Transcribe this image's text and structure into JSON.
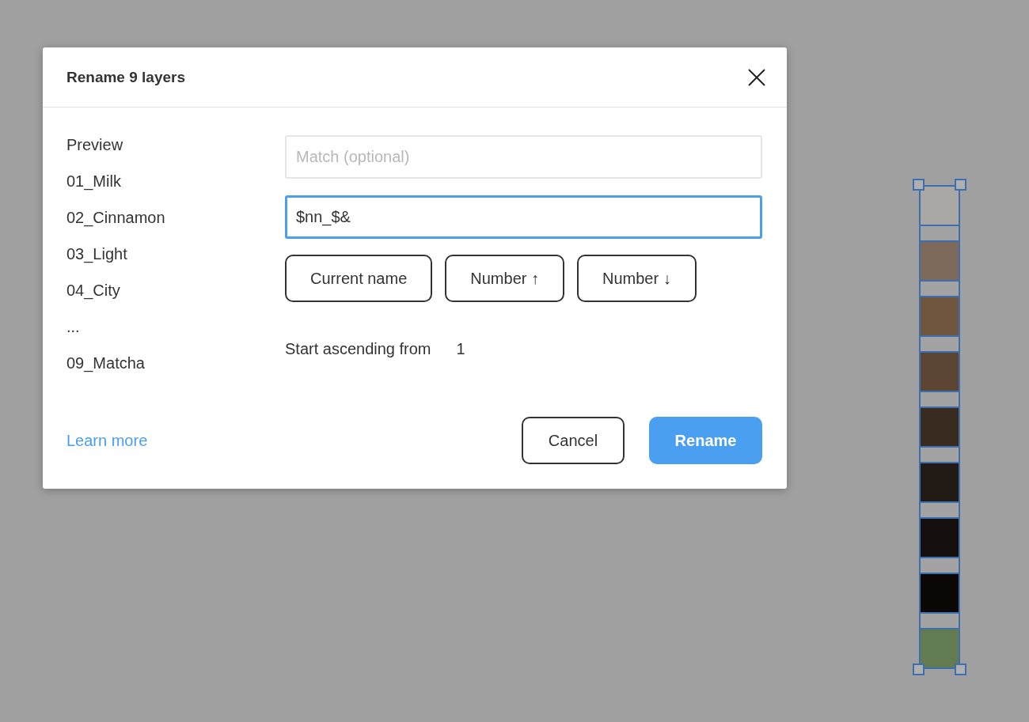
{
  "dialog": {
    "title": "Rename 9 layers",
    "preview": {
      "heading": "Preview",
      "items": [
        "01_Milk",
        "02_Cinnamon",
        "03_Light",
        "04_City",
        "...",
        "09_Matcha"
      ]
    },
    "match_field": {
      "placeholder": "Match (optional)",
      "focused": false
    },
    "rename_field": {
      "value": "$nn_$&",
      "focused": true
    },
    "token_buttons": [
      "Current name",
      "Number ↑",
      "Number ↓"
    ],
    "start": {
      "label": "Start ascending from",
      "value": "1"
    },
    "learn_more": "Learn more",
    "buttons": [
      {
        "label": "Cancel",
        "kind": "secondary"
      },
      {
        "label": "Rename",
        "kind": "primary"
      }
    ]
  },
  "canvas": {
    "swatches": [
      {
        "color": "#a9a8a5"
      },
      {
        "color": "#7d6a5a"
      },
      {
        "color": "#70553f"
      },
      {
        "color": "#5d4534"
      },
      {
        "color": "#3a2b21"
      },
      {
        "color": "#221a15"
      },
      {
        "color": "#15100d"
      },
      {
        "color": "#0b0705"
      },
      {
        "color": "#627b51"
      }
    ]
  }
}
